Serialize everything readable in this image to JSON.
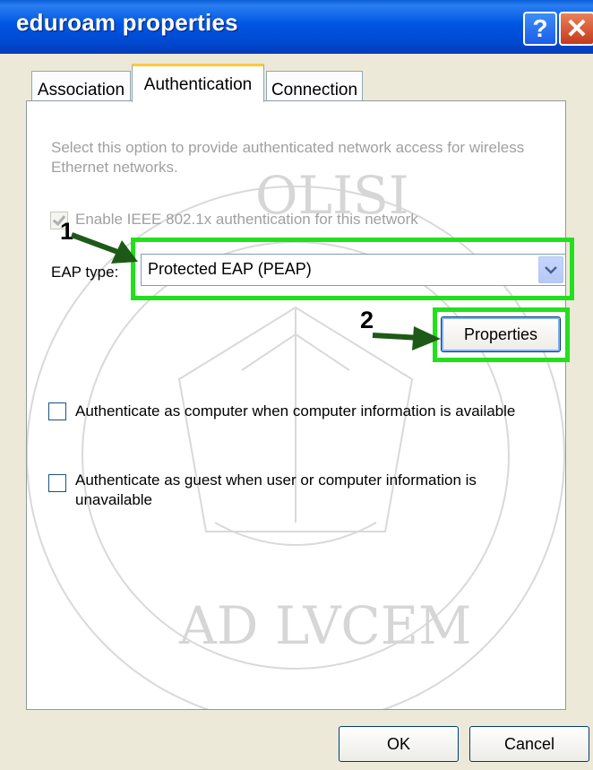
{
  "window": {
    "title": "eduroam properties"
  },
  "titlebar_buttons": {
    "help_glyph": "?",
    "close_glyph": "✕"
  },
  "tabs": [
    {
      "label": "Association"
    },
    {
      "label": "Authentication",
      "active": true
    },
    {
      "label": "Connection"
    }
  ],
  "auth": {
    "description": "Select this option to provide authenticated network access for wireless Ethernet networks.",
    "enable_8021x": {
      "label": "Enable IEEE 802.1x authentication for this network",
      "checked": true,
      "disabled": true
    },
    "eap_type": {
      "label": "EAP type:",
      "value": "Protected EAP (PEAP)"
    },
    "properties_button": "Properties",
    "auth_as_computer": {
      "label": "Authenticate as computer when computer information is available",
      "checked": false
    },
    "auth_as_guest": {
      "label": "Authenticate as guest when user or computer information is unavailable",
      "checked": false
    }
  },
  "annotations": {
    "step1": "1",
    "step2": "2",
    "highlight_color": "#22e01c",
    "arrow_color": "#1d5a17"
  },
  "footer": {
    "ok": "OK",
    "cancel": "Cancel"
  },
  "watermark_text": [
    "OLISI",
    "AD LVCEM"
  ]
}
